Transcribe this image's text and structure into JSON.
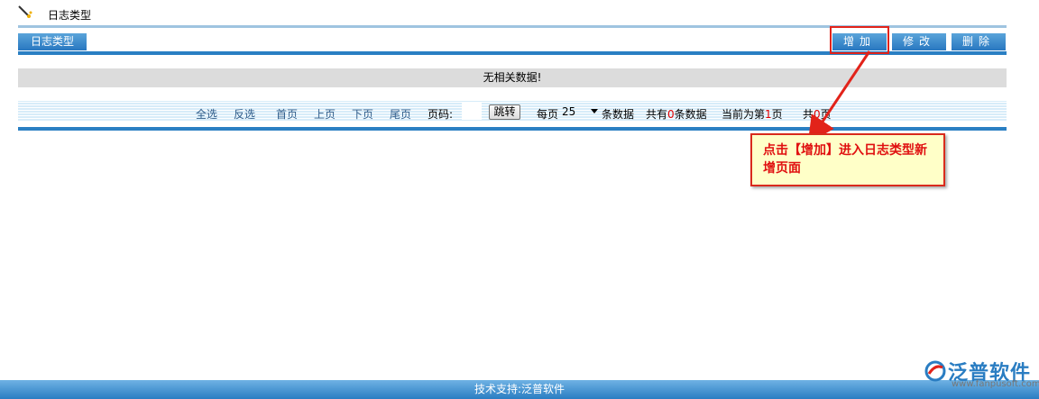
{
  "page": {
    "title": "日志类型"
  },
  "header": {
    "tab_label": "日志类型"
  },
  "toolbar": {
    "add_label": "增加",
    "edit_label": "修改",
    "delete_label": "删除"
  },
  "grid": {
    "empty_message": "无相关数据!"
  },
  "pager": {
    "select_all": "全选",
    "invert_select": "反选",
    "first": "首页",
    "prev": "上页",
    "next": "下页",
    "last": "尾页",
    "page_no_label": "页码:",
    "page_no_value": "",
    "jump_label": "跳转",
    "per_page_label": "每页",
    "per_page_value": "25",
    "per_page_suffix": "条数据",
    "total_prefix": "共有",
    "total_count": "0",
    "total_suffix": "条数据",
    "current_prefix": "当前为第",
    "current_page": "1",
    "current_suffix": "页",
    "pages_prefix": "共",
    "pages_count": "0",
    "pages_suffix": "页"
  },
  "annotation": {
    "callout_text": "点击【增加】进入日志类型新增页面"
  },
  "footer": {
    "text": "技术支持:泛普软件",
    "brand_name": "泛普软件",
    "brand_url": "www.fanpusoft.com"
  },
  "colors": {
    "accent": "#2a7fc3",
    "annotation_red": "#e2231a",
    "callout_bg": "#ffffc8"
  }
}
